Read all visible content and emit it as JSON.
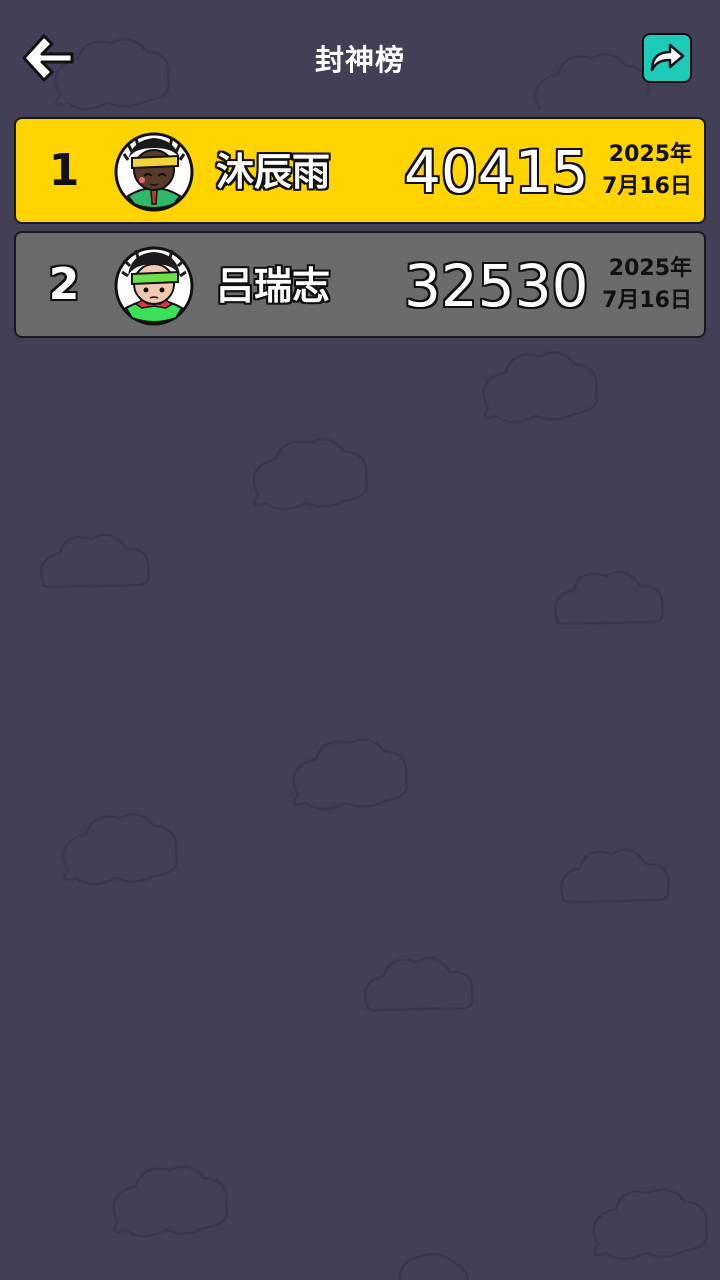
{
  "header": {
    "title": "封神榜",
    "back_icon": "arrow-left-icon",
    "share_icon": "share-arrow-icon",
    "share_color": "#1dcbb8"
  },
  "leaderboard": [
    {
      "rank": "1",
      "name": "沐辰雨",
      "score": "40415",
      "date_line1": "2025年",
      "date_line2": "7月16日",
      "row_color": "#ffd400",
      "avatar": "player-avatar-yellow-headband"
    },
    {
      "rank": "2",
      "name": "吕瑞志",
      "score": "32530",
      "date_line1": "2025年",
      "date_line2": "7月16日",
      "row_color": "#6b6b6b",
      "avatar": "player-avatar-green-headband"
    }
  ]
}
